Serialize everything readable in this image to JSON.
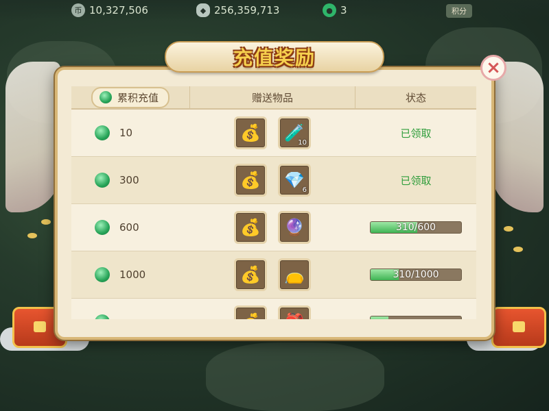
{
  "resources": [
    {
      "icon": "silver-coin-icon",
      "value": "10,327,506"
    },
    {
      "icon": "ingot-icon",
      "value": "256,359,713"
    },
    {
      "icon": "jade-icon",
      "value": "3"
    }
  ],
  "topbar": {
    "button_label": "积分"
  },
  "dialog": {
    "title": "充值奖励",
    "close_label": "×"
  },
  "table": {
    "headers": {
      "amount": "累积充值",
      "rewards": "赠送物品",
      "status": "状态"
    },
    "rows": [
      {
        "amount": "10",
        "items": [
          {
            "icon": "money-bag-icon",
            "glyph": "💰",
            "count": ""
          },
          {
            "icon": "potion-bottle-icon",
            "glyph": "🧪",
            "count": "10"
          }
        ],
        "status_type": "claimed",
        "status_text": "已领取"
      },
      {
        "amount": "300",
        "items": [
          {
            "icon": "money-bag-icon",
            "glyph": "💰",
            "count": ""
          },
          {
            "icon": "crystal-shard-icon",
            "glyph": "💎",
            "count": "6"
          }
        ],
        "status_type": "claimed",
        "status_text": "已领取"
      },
      {
        "amount": "600",
        "items": [
          {
            "icon": "money-bag-icon",
            "glyph": "💰",
            "count": ""
          },
          {
            "icon": "crystal-orb-icon",
            "glyph": "🔮",
            "count": ""
          }
        ],
        "status_type": "progress",
        "status_text": "310/600",
        "progress": 0.517
      },
      {
        "amount": "1000",
        "items": [
          {
            "icon": "money-bag-icon",
            "glyph": "💰",
            "count": ""
          },
          {
            "icon": "gift-pouch-icon",
            "glyph": "👝",
            "count": ""
          }
        ],
        "status_type": "progress",
        "status_text": "310/1000",
        "progress": 0.31
      },
      {
        "amount": "",
        "items": [
          {
            "icon": "money-bag-icon",
            "glyph": "💰",
            "count": ""
          },
          {
            "icon": "red-pouch-icon",
            "glyph": "🎒",
            "count": ""
          }
        ],
        "status_type": "progress",
        "status_text": "",
        "progress": 0.2
      }
    ]
  },
  "colors": {
    "claimed": "#2f9d3b",
    "progress_fill": "#3fb454",
    "title": "#f6d04e"
  }
}
